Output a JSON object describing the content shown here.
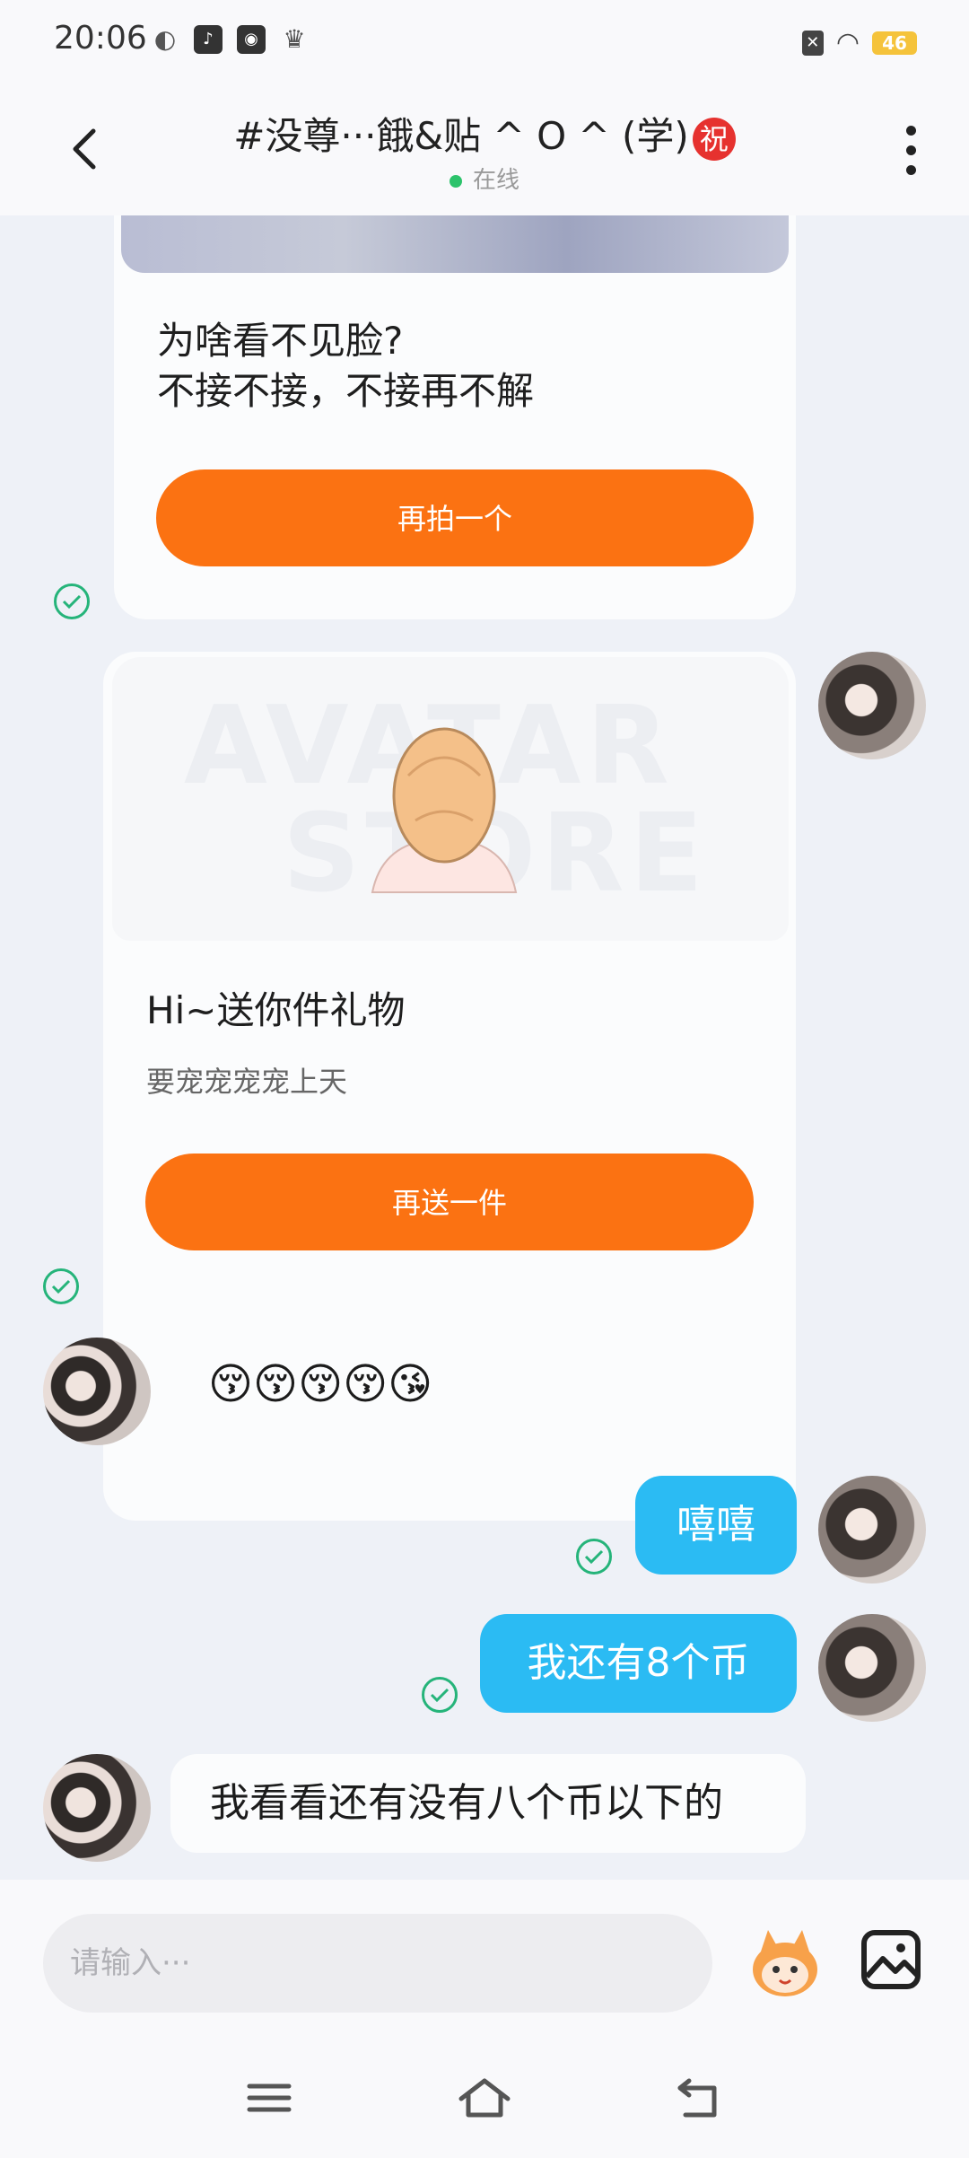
{
  "status_bar": {
    "time": "20:06",
    "battery": "46"
  },
  "header": {
    "title": "#没尊···餓&贴 ^ O ^ (学)",
    "title_badge": "祝",
    "status": "在线"
  },
  "messages": {
    "card1": {
      "line1": "为啥看不见脸?",
      "line2": "不接不接，不接再不解",
      "button": "再拍一个"
    },
    "card2": {
      "watermark1": "AVATAR",
      "watermark2": "STORE",
      "title": "Hi~送你件礼物",
      "subtitle": "要宠宠宠宠上天",
      "button": "再送一件"
    },
    "emoji_msg": "😚😚😚😚😘",
    "me1": "嘻嘻",
    "me2": "我还有8个币",
    "other2": "我看看还有没有八个币以下的"
  },
  "input": {
    "placeholder": "请输入···"
  },
  "colors": {
    "accent_orange": "#fb7212",
    "bubble_blue": "#2bbbf3",
    "check_green": "#25b47a"
  }
}
